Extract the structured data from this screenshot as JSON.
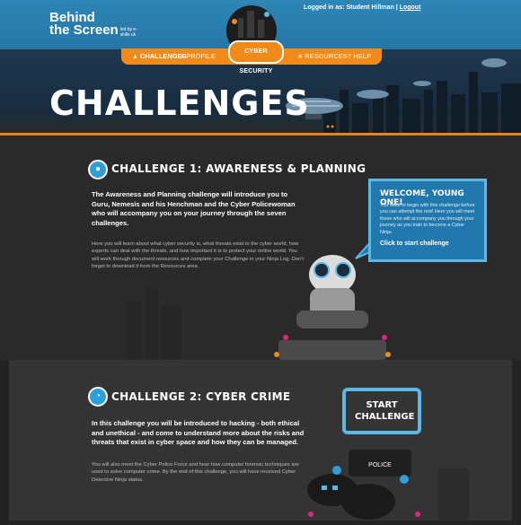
{
  "header": {
    "logo_line1": "Behind",
    "logo_line2": "the Screen",
    "logo_tagline": "led by e-skills uk",
    "login_prefix": "Logged in as:",
    "user_name": "Student Hillman",
    "separator": "|",
    "logout_label": "Logout",
    "emblem_label": "CYBER SECURITY"
  },
  "nav": {
    "challenges": "Challenges",
    "profile": "Profile",
    "resources": "Resources",
    "help": "Help"
  },
  "banner": {
    "title": "CHALLENGES"
  },
  "challenge1": {
    "title": "Challenge 1: Awareness & Planning",
    "intro": "The Awareness and Planning challenge will introduce you to Guru, Nemesis and his Henchman and the Cyber Policewoman who will accompany you on your journey through the seven challenges.",
    "body": "Here you will learn about what cyber security is, what threats exist to the cyber world, how experts can deal with the threats, and how important it is to protect your online world.  You will work through document resources and complete your Challenge in your Ninja Log. Don't forget to download it from the Resources area."
  },
  "welcome": {
    "title": "Welcome, young one!",
    "text": "You need to begin with this challenge before you can attempt the rest! Here you will meet those who will accompany you through your journey as you train to become a Cyber Ninja.",
    "link": "Click to start challenge"
  },
  "challenge2": {
    "title": "Challenge 2: Cyber Crime",
    "intro": "In this challenge you will be introduced to hacking - both ethical and unethical - and come to understand more about the risks and threats that exist in cyber space and how they can be managed.",
    "body": "You will also meet the Cyber Police Force and hear how computer forensic techniques are used to solve computer crime. By the end of this challenge, you will have received Cyber Detective Ninja status.",
    "start_label": "START CHALLENGE",
    "police_label": "POLICE"
  },
  "colors": {
    "accent": "#f08a19",
    "header": "#2e86b6",
    "welcome_bg": "#2178ad"
  }
}
